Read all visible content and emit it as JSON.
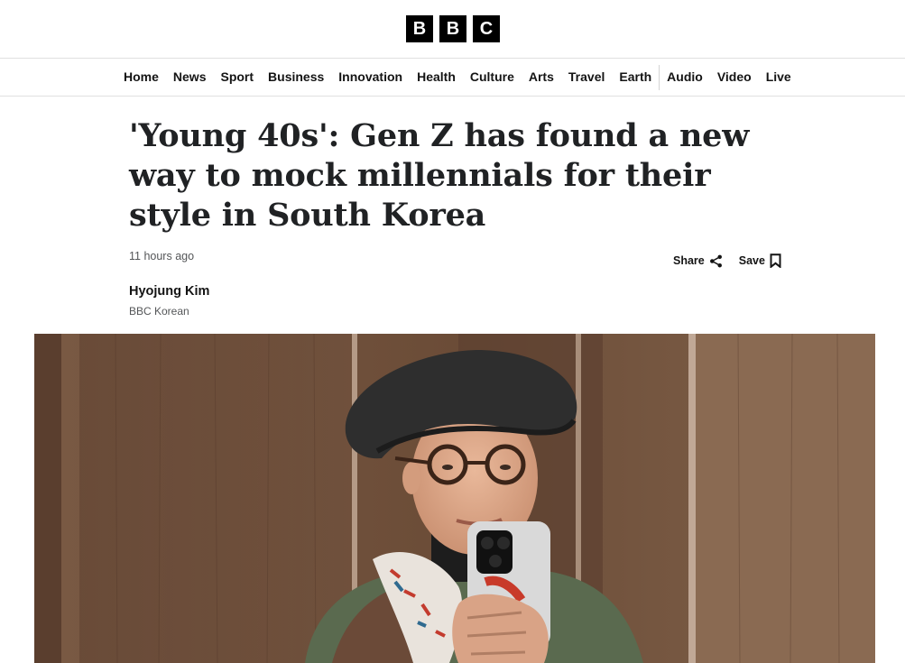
{
  "brand": {
    "letters": [
      "B",
      "B",
      "C"
    ]
  },
  "nav": {
    "items": [
      "Home",
      "News",
      "Sport",
      "Business",
      "Innovation",
      "Health",
      "Culture",
      "Arts",
      "Travel",
      "Earth",
      "Audio",
      "Video",
      "Live"
    ]
  },
  "article": {
    "headline": "'Young 40s': Gen Z has found a new way to mock millennials for their style in South Korea",
    "timestamp": "11 hours ago",
    "author": {
      "name": "Hyojung Kim",
      "org": "BBC Korean"
    }
  },
  "actions": {
    "share_label": "Share",
    "save_label": "Save"
  },
  "icons": {
    "share": "share-icon",
    "save": "bookmark-icon"
  },
  "colors": {
    "brand": "#000000",
    "text": "#141414",
    "muted": "#545658"
  }
}
